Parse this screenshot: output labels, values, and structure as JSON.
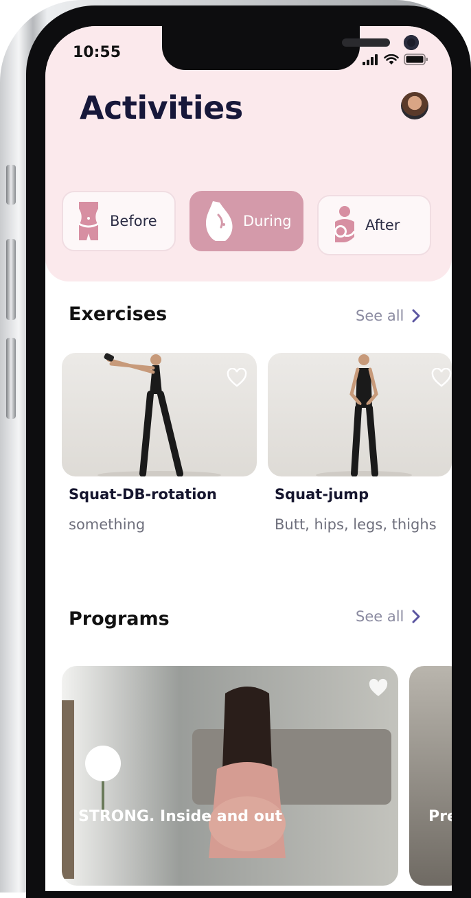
{
  "status_bar": {
    "time": "10:55"
  },
  "header": {
    "title": "Activities"
  },
  "categories": [
    {
      "label": "Before",
      "icon": "waist-icon",
      "active": false
    },
    {
      "label": "During",
      "icon": "pregnant-belly-icon",
      "active": true
    },
    {
      "label": "After",
      "icon": "mother-baby-icon",
      "active": false
    }
  ],
  "exercises": {
    "title": "Exercises",
    "see_all": "See all",
    "items": [
      {
        "name": "Squat-DB-rotation",
        "subtitle": "something"
      },
      {
        "name": "Squat-jump",
        "subtitle": "Butt, hips, legs, thighs"
      }
    ]
  },
  "programs": {
    "title": "Programs",
    "see_all": "See all",
    "items": [
      {
        "name": "STRONG. Inside and out"
      },
      {
        "name": "Pre"
      }
    ]
  },
  "colors": {
    "accent": "#d49aaa",
    "header_bg": "#fbe9ec",
    "title": "#17183a",
    "chevron": "#5b55a0"
  }
}
